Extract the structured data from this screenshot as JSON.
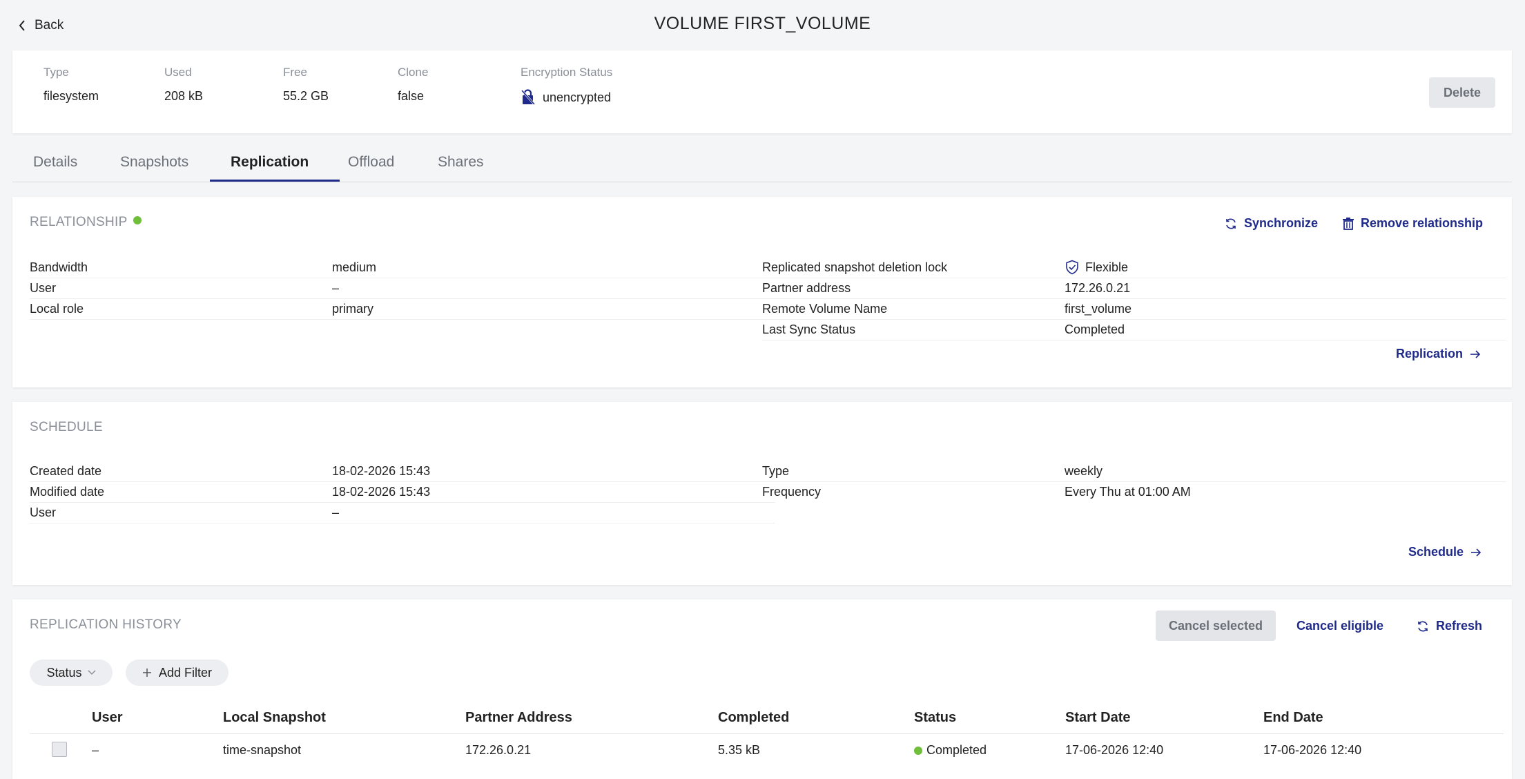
{
  "header": {
    "back_label": "Back",
    "title": "VOLUME FIRST_VOLUME"
  },
  "summary": {
    "type_label": "Type",
    "type_value": "filesystem",
    "used_label": "Used",
    "used_value": "208 kB",
    "free_label": "Free",
    "free_value": "55.2 GB",
    "clone_label": "Clone",
    "clone_value": "false",
    "encryption_label": "Encryption Status",
    "encryption_value": "unencrypted",
    "delete_label": "Delete"
  },
  "tabs": [
    {
      "label": "Details"
    },
    {
      "label": "Snapshots"
    },
    {
      "label": "Replication"
    },
    {
      "label": "Offload"
    },
    {
      "label": "Shares"
    }
  ],
  "relationship": {
    "title": "RELATIONSHIP",
    "synchronize_label": "Synchronize",
    "remove_label": "Remove relationship",
    "left": [
      {
        "key": "Bandwidth",
        "value": "medium"
      },
      {
        "key": "User",
        "value": "–"
      },
      {
        "key": "Local role",
        "value": "primary"
      }
    ],
    "right": [
      {
        "key": "Replicated snapshot deletion lock",
        "value": "Flexible"
      },
      {
        "key": "Partner address",
        "value": "172.26.0.21"
      },
      {
        "key": "Remote Volume Name",
        "value": "first_volume"
      },
      {
        "key": "Last Sync Status",
        "value": "Completed"
      }
    ],
    "link_label": "Replication"
  },
  "schedule": {
    "title": "SCHEDULE",
    "left": [
      {
        "key": "Created date",
        "value": "18-02-2026 15:43"
      },
      {
        "key": "Modified date",
        "value": "18-02-2026 15:43"
      },
      {
        "key": "User",
        "value": "–"
      }
    ],
    "right": [
      {
        "key": "Type",
        "value": "weekly"
      },
      {
        "key": "Frequency",
        "value": "Every Thu at 01:00 AM"
      }
    ],
    "link_label": "Schedule"
  },
  "history": {
    "title": "REPLICATION HISTORY",
    "cancel_selected_label": "Cancel selected",
    "cancel_eligible_label": "Cancel eligible",
    "refresh_label": "Refresh",
    "status_filter_label": "Status",
    "add_filter_label": "Add Filter",
    "columns": [
      "User",
      "Local Snapshot",
      "Partner Address",
      "Completed",
      "Status",
      "Start Date",
      "End Date"
    ],
    "rows": [
      {
        "user": "–",
        "local_snapshot": "time-snapshot",
        "partner_address": "172.26.0.21",
        "completed": "5.35 kB",
        "status": "Completed",
        "start_date": "17-06-2026 12:40",
        "end_date": "17-06-2026 12:40"
      }
    ]
  },
  "colors": {
    "accent": "#1f2a8a",
    "success": "#6fbf3a"
  }
}
